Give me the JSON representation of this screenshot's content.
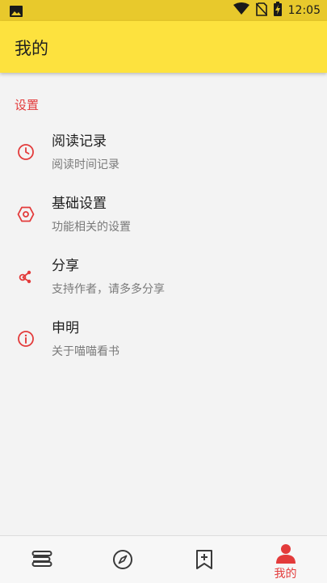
{
  "status_bar": {
    "time": "12:05",
    "icons": [
      "image-icon",
      "wifi-icon",
      "no-sim-icon",
      "battery-charging-icon"
    ]
  },
  "app_bar": {
    "title": "我的"
  },
  "settings": {
    "section_title": "设置",
    "items": [
      {
        "title": "阅读记录",
        "subtitle": "阅读时间记录",
        "icon": "clock-icon"
      },
      {
        "title": "基础设置",
        "subtitle": "功能相关的设置",
        "icon": "hexagon-settings-icon"
      },
      {
        "title": "分享",
        "subtitle": "支持作者，请多多分享",
        "icon": "share-icon"
      },
      {
        "title": "申明",
        "subtitle": "关于喵喵看书",
        "icon": "info-icon"
      }
    ]
  },
  "bottom_nav": {
    "items": [
      {
        "icon": "bookshelf-icon"
      },
      {
        "icon": "compass-icon"
      },
      {
        "icon": "bookmark-add-icon"
      },
      {
        "icon": "person-icon",
        "label": "我的"
      }
    ],
    "active_index": 3
  },
  "colors": {
    "accent": "#e33b3b",
    "app_bar": "#fde23e",
    "status_bar": "#e8c92c",
    "background": "#f3f3f3"
  }
}
